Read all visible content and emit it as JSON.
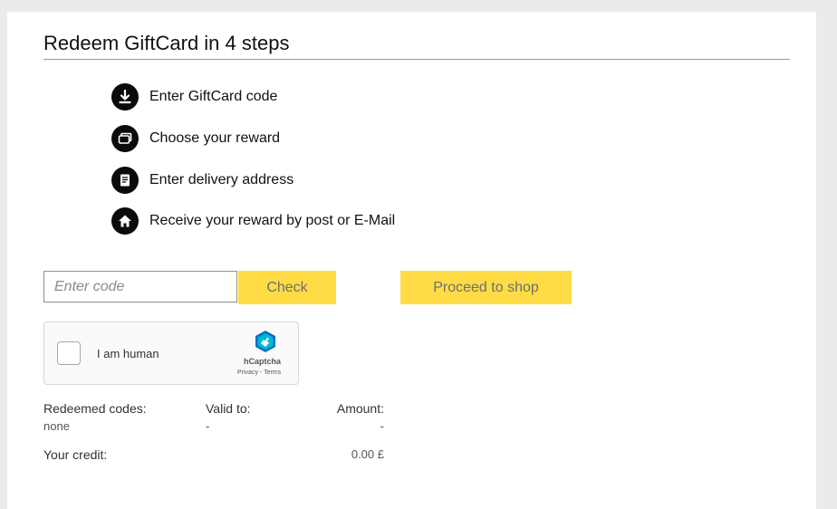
{
  "page": {
    "title": "Redeem GiftCard in 4 steps"
  },
  "steps": [
    {
      "icon": "download-arrow-icon",
      "label": "Enter GiftCard code"
    },
    {
      "icon": "cards-icon",
      "label": "Choose your reward"
    },
    {
      "icon": "document-icon",
      "label": "Enter delivery address"
    },
    {
      "icon": "home-icon",
      "label": "Receive your reward by post or E-Mail"
    }
  ],
  "code_form": {
    "placeholder": "Enter code",
    "value": "",
    "check_label": "Check",
    "proceed_label": "Proceed to shop"
  },
  "captcha": {
    "label": "I am human",
    "brand": "hCaptcha",
    "privacy": "Privacy",
    "separator": " - ",
    "terms": "Terms",
    "checked": false
  },
  "redeemed": {
    "headers": {
      "codes": "Redeemed codes:",
      "valid": "Valid to:",
      "amount": "Amount:"
    },
    "row": {
      "codes": "none",
      "valid": "-",
      "amount": "-"
    }
  },
  "credit": {
    "label": "Your credit:",
    "value": "0.00 £"
  },
  "colors": {
    "accent_yellow": "#ffdc45",
    "icon_black": "#0b0b0b",
    "page_background": "#ebebeb"
  }
}
